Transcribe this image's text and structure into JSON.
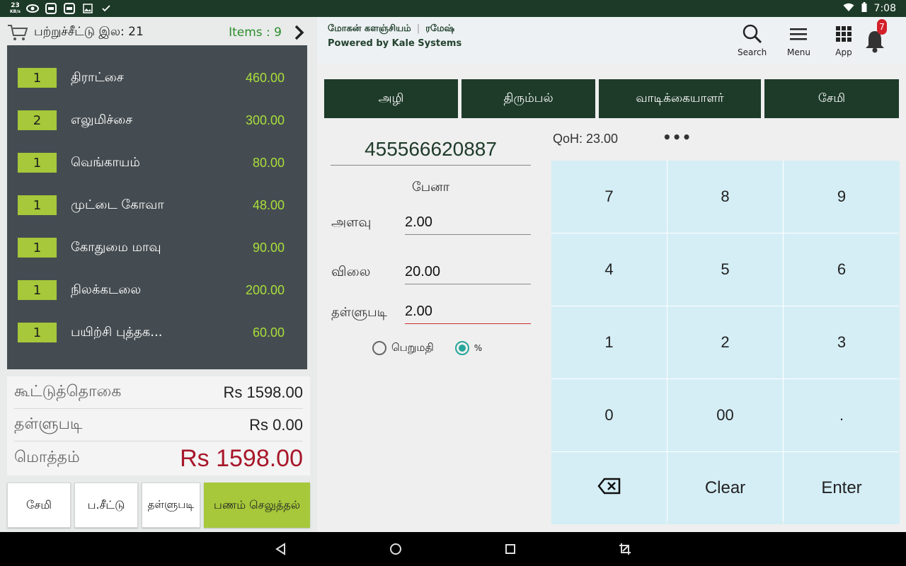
{
  "status_bar": {
    "kbs_value": "23",
    "kbs_unit": "KB/s",
    "time": "7:08"
  },
  "cart": {
    "receipt_label": "பற்றுச்சீட்டு இல: 21",
    "items_label": "Items : 9",
    "items": [
      {
        "qty": "1",
        "name": "திராட்சை",
        "price": "460.00"
      },
      {
        "qty": "2",
        "name": "எலுமிச்சை",
        "price": "300.00"
      },
      {
        "qty": "1",
        "name": "வெங்காயம்",
        "price": "80.00"
      },
      {
        "qty": "1",
        "name": "முட்டை கோவா",
        "price": "48.00"
      },
      {
        "qty": "1",
        "name": "கோதுமை மாவு",
        "price": "90.00"
      },
      {
        "qty": "1",
        "name": "நிலக்கடலை",
        "price": "200.00"
      },
      {
        "qty": "1",
        "name": "பயிற்சி புத்தக...",
        "price": "60.00"
      }
    ]
  },
  "totals": {
    "subtotal_label": "கூட்டுத்தொகை",
    "subtotal_value": "Rs  1598.00",
    "discount_label": "தள்ளுபடி",
    "discount_value": "Rs  0.00",
    "grand_label": "மொத்தம்",
    "grand_value": "Rs 1598.00"
  },
  "actions": {
    "save": "சேமி",
    "receipt": "ப.சீட்டு",
    "discount": "தள்ளுபடி",
    "pay": "பணம் செலுத்தல்"
  },
  "header": {
    "store_name": "மோகன் களஞ்சியம்",
    "separator": "|",
    "user": "ரமேஷ்",
    "powered_by": "Powered by Kale Systems",
    "search_label": "Search",
    "menu_label": "Menu",
    "app_label": "App",
    "notification_count": "7"
  },
  "tabs": [
    "அழி",
    "திரும்பல்",
    "வாடிக்கையாளர்",
    "சேமி"
  ],
  "product": {
    "barcode": "455566620887",
    "name": "பேனா",
    "qty_label": "அளவு",
    "qty_value": "2.00",
    "price_label": "விலை",
    "price_value": "20.00",
    "discount_label": "தள்ளுபடி",
    "discount_value": "2.00",
    "radio_value_label": "பெறுமதி",
    "radio_percent_label": "%",
    "qoh": "QoH: 23.00",
    "more": "•••"
  },
  "keypad": {
    "k7": "7",
    "k8": "8",
    "k9": "9",
    "k4": "4",
    "k5": "5",
    "k6": "6",
    "k1": "1",
    "k2": "2",
    "k3": "3",
    "k0": "0",
    "k00": "00",
    "kdot": ".",
    "clear": "Clear",
    "enter": "Enter"
  },
  "colors": {
    "dark_green": "#1e3b2a",
    "lime": "#a6c83a",
    "price_green": "#a9df3a",
    "grand_total_red": "#a8162a",
    "keypad_blue": "#d5eef6"
  }
}
